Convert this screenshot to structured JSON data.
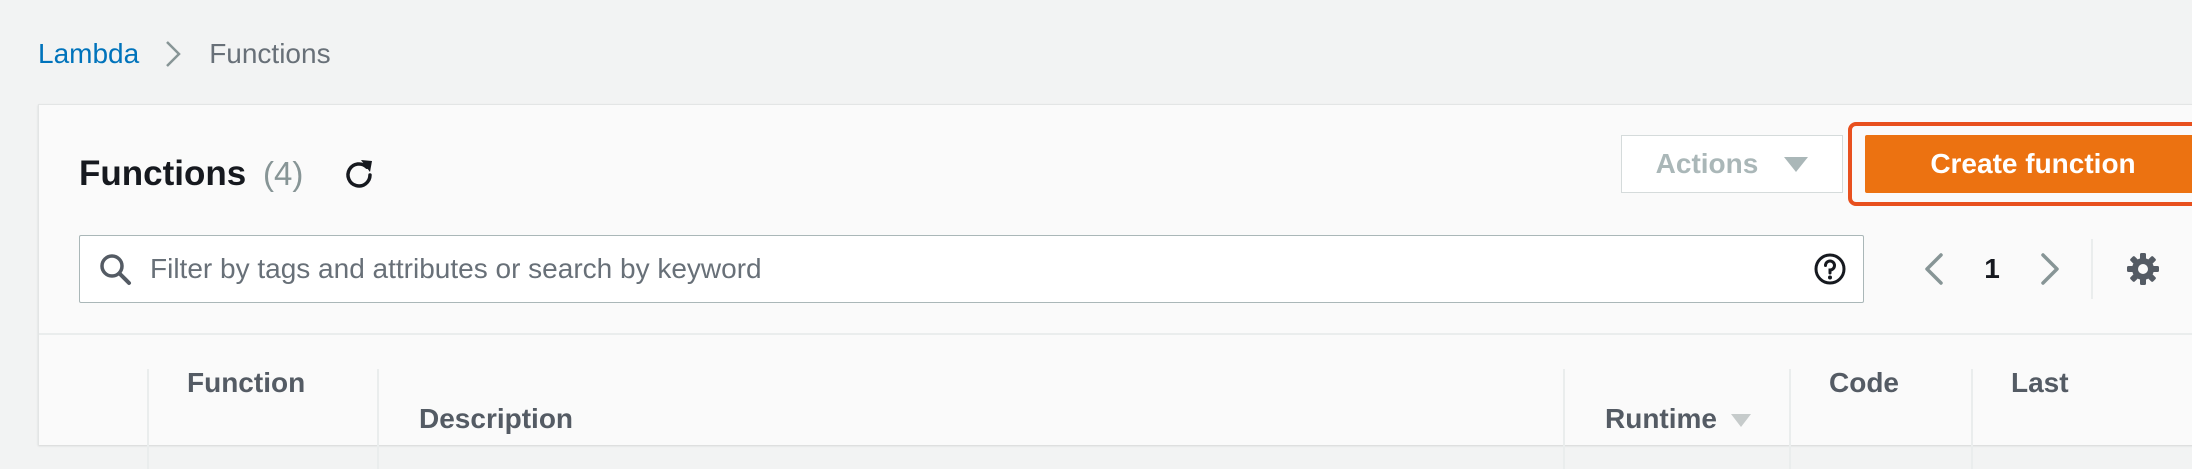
{
  "breadcrumb": {
    "root": "Lambda",
    "current": "Functions"
  },
  "panel": {
    "title": "Functions",
    "count": "(4)"
  },
  "toolbar": {
    "actions_label": "Actions",
    "create_label": "Create function"
  },
  "search": {
    "placeholder": "Filter by tags and attributes or search by keyword",
    "value": ""
  },
  "pagination": {
    "current_page": "1"
  },
  "table": {
    "columns": [
      {
        "label": "Function"
      },
      {
        "label": "Description"
      },
      {
        "label": "Runtime"
      },
      {
        "label": "Code"
      },
      {
        "label": "Last"
      }
    ]
  },
  "colors": {
    "link": "#0073bb",
    "primary_button": "#ec7211",
    "highlight_outline": "#e8501e",
    "muted_text": "#879596",
    "background": "#f2f3f3"
  },
  "icons": {
    "breadcrumb_separator": "chevron-right-icon",
    "refresh": "refresh-icon",
    "actions_caret": "caret-down-icon",
    "search": "search-icon",
    "help": "help-icon",
    "prev_page": "chevron-left-icon",
    "next_page": "chevron-right-icon",
    "settings": "gear-icon",
    "sort": "sort-caret-icon"
  }
}
